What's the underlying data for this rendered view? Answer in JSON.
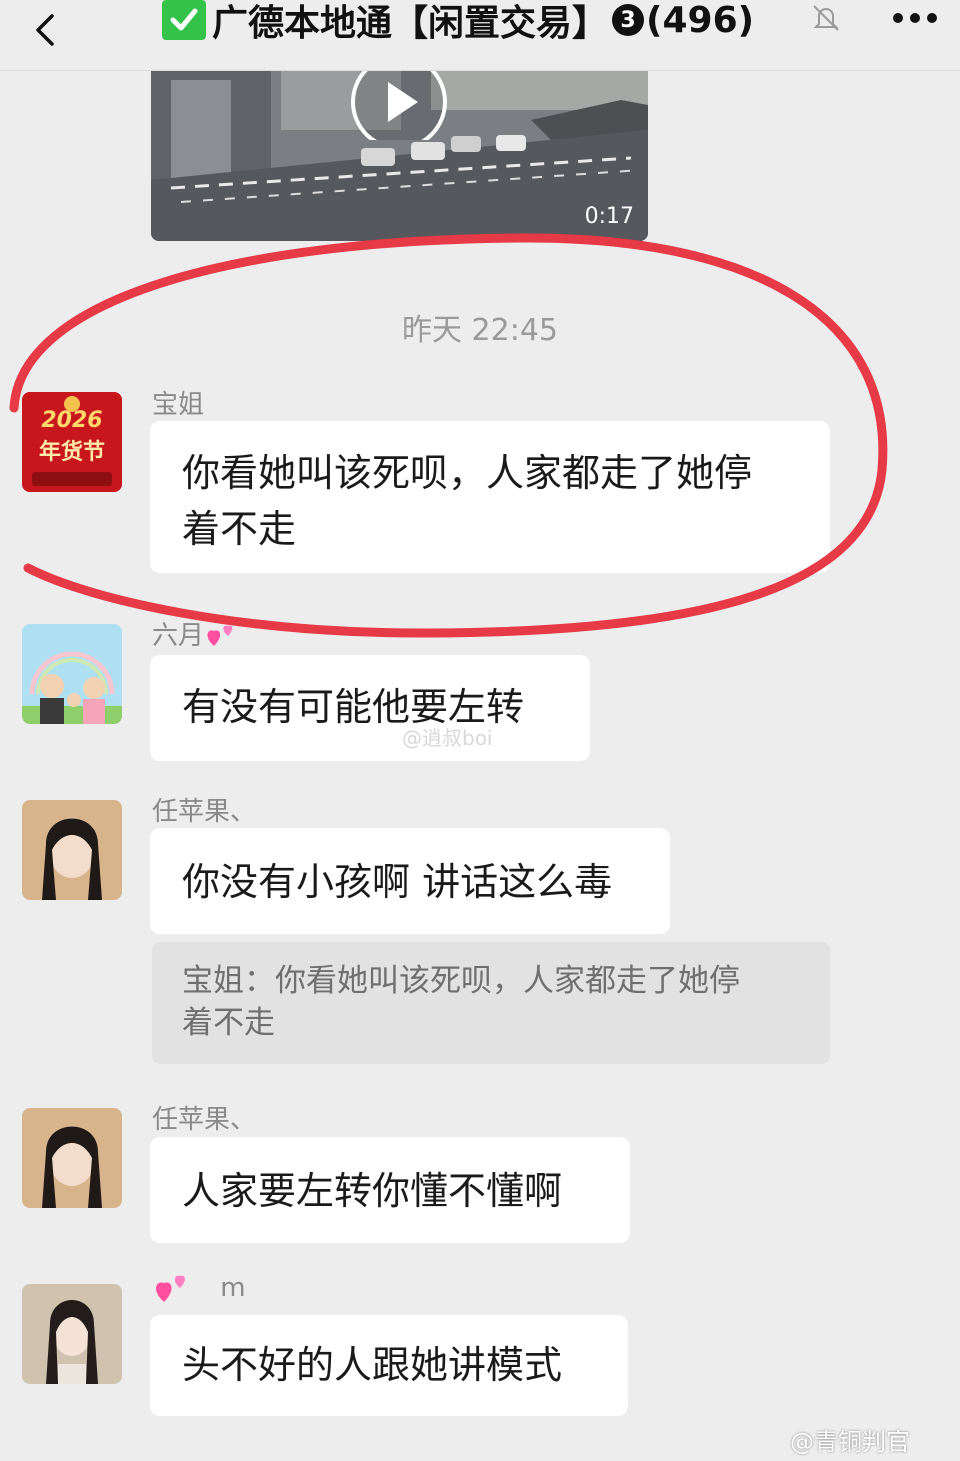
{
  "header": {
    "title": "广德本地通【闲置交易】",
    "unread_badge": "3",
    "member_count": "(496)",
    "back_icon": "chevron-left-icon",
    "mute_icon": "bell-muted-icon",
    "more_icon": "more-dots-icon"
  },
  "video": {
    "duration": "0:17",
    "play_icon": "play-icon"
  },
  "timestamp": "昨天 22:45",
  "messages": [
    {
      "sender": "宝姐",
      "text_line1": "你看她叫该死呗，人家都走了她停",
      "text_line2": "着不走"
    },
    {
      "sender": "六月",
      "text": "有没有可能他要左转"
    },
    {
      "sender": "任苹果、",
      "text": "你没有小孩啊 讲话这么毒",
      "quote_line1": "宝姐：你看她叫该死呗，人家都走了她停",
      "quote_line2": "着不走"
    },
    {
      "sender": "任苹果、",
      "text": "人家要左转你懂不懂啊"
    },
    {
      "sender": "m",
      "text": "头不好的人跟她讲模式"
    }
  ],
  "avatar_texts": {
    "first": "2026",
    "first_sub": "年货节"
  },
  "watermarks": {
    "center": "@逍叔boi",
    "bottom": "@青铜判官"
  },
  "colors": {
    "annotation_circle": "#e63a46",
    "check_green": "#33c24a"
  }
}
